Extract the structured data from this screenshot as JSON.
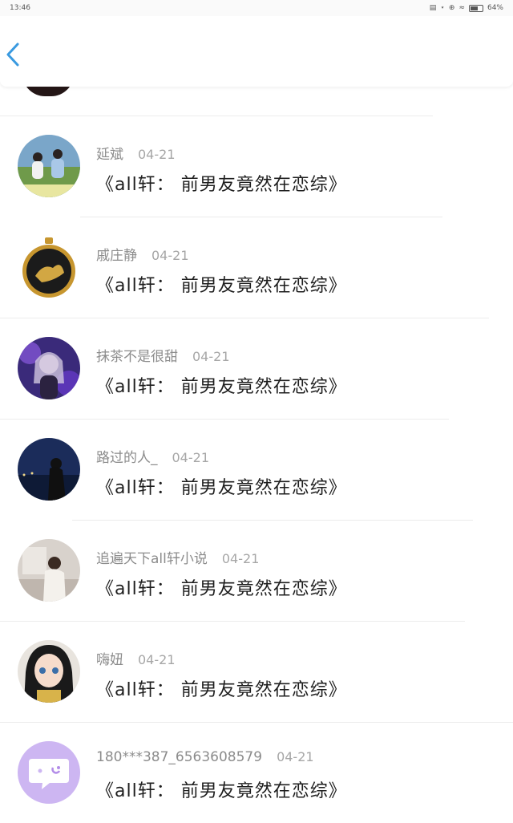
{
  "status_bar": {
    "time": "13:46",
    "battery": "64%",
    "battery_level": 0.64
  },
  "comments": [
    {
      "name": "延斌",
      "date": "04-21",
      "message": "《all轩： 前男友竟然在恋综》"
    },
    {
      "name": "戚庄静",
      "date": "04-21",
      "message": "《all轩： 前男友竟然在恋综》"
    },
    {
      "name": "抹茶不是很甜",
      "date": "04-21",
      "message": "《all轩： 前男友竟然在恋综》"
    },
    {
      "name": "路过的人_",
      "date": "04-21",
      "message": "《all轩： 前男友竟然在恋综》"
    },
    {
      "name": "追遍天下all轩小说",
      "date": "04-21",
      "message": "《all轩： 前男友竟然在恋综》"
    },
    {
      "name": "嗨妞",
      "date": "04-21",
      "message": "《all轩： 前男友竟然在恋综》"
    },
    {
      "name": "180***387_6563608579",
      "date": "04-21",
      "message": "《all轩： 前男友竟然在恋综》"
    }
  ],
  "colors": {
    "accent": "#3a9ae0",
    "name": "#8c8c8c",
    "message": "#1e1e1e"
  }
}
